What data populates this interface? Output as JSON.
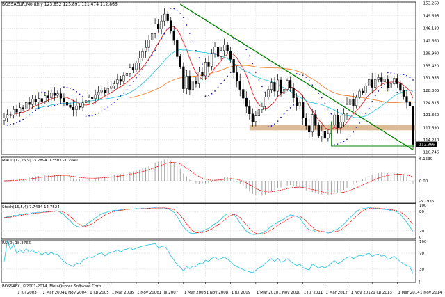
{
  "header": {
    "title": "BOSSAEUR,Monthly  123.852 123.891 111.474 112.866"
  },
  "panels": {
    "macd_label": "MACD(12,26,9) -3.2894 0.3507 -1.2940",
    "stoch_label": "Stoch(15,5,4) 7.7434 14.7524",
    "rsi_label": "RSI(9) 18.3766"
  },
  "footer": {
    "copyright": "BOSSAFX, ©2001-2014, MetaQuotes Software Corp."
  },
  "colors": {
    "background": "#ffffff",
    "grid": "#d8d8d8",
    "candle_bull": "#ffffff",
    "candle_bear": "#000000",
    "ma_red": "#e02020",
    "ma_cyan": "#30c8e0",
    "ma_orange": "#f08030",
    "psar": "#2020c0",
    "trendline": "#008000",
    "support_zone": "#d9b48c",
    "macd_signal": "#ff0000",
    "stoch_main": "#30c8e0",
    "stoch_signal": "#ff0000",
    "rsi": "#30c8e0"
  },
  "chart_data": [
    {
      "type": "candlestick",
      "symbol": "BOSSAEUR",
      "timeframe": "Monthly",
      "last_bar": {
        "open": 123.852,
        "high": 123.891,
        "low": 111.474,
        "close": 112.866
      },
      "yticks": [
        110.746,
        114.21,
        117.69,
        121.36,
        124.815,
        128.305,
        131.955,
        135.42,
        138.99,
        142.56,
        146.13,
        149.695,
        153.26
      ],
      "ylim": [
        110.0,
        153.6
      ],
      "current_price_label": "112.866",
      "xticks": [
        "1 Jul 2003",
        "1 Mar 2004",
        "1 Nov 2004",
        "1 Jul 2005",
        "1 Mar 2006",
        "1 Nov 2006",
        "1 Jul 2007",
        "1 Mar 2008",
        "1 Nov 2008",
        "1 Jul 2009",
        "1 Mar 2010",
        "1 Nov 2010",
        "1 Jul 2011",
        "1 Mar 2012",
        "1 Nov 2012",
        "1 Jul 2013",
        "1 Mar 2014",
        "1 Nov 2014"
      ],
      "close": [
        120.5,
        121.4,
        121.2,
        122.9,
        122.1,
        123.4,
        123.0,
        124.9,
        124.3,
        125.8,
        125.1,
        126.0,
        125.2,
        126.8,
        126.2,
        127.6,
        126.9,
        127.4,
        126.1,
        125.0,
        124.1,
        123.5,
        122.8,
        123.9,
        123.5,
        124.8,
        125.4,
        126.3,
        126.0,
        127.1,
        127.9,
        128.4,
        127.6,
        128.9,
        129.6,
        130.2,
        131.4,
        130.9,
        132.6,
        133.2,
        134.8,
        134.3,
        136.2,
        137.6,
        139.4,
        140.6,
        142.8,
        144.6,
        147.4,
        146.0,
        148.2,
        150.2,
        148.3,
        145.4,
        142.6,
        138.0,
        135.1,
        128.8,
        132.4,
        128.6,
        131.0,
        130.2,
        133.6,
        132.5,
        136.4,
        135.2,
        138.9,
        140.8,
        138.0,
        139.7,
        141.3,
        139.6,
        137.2,
        133.4,
        131.0,
        128.6,
        126.1,
        123.7,
        121.6,
        119.4,
        121.0,
        122.8,
        123.7,
        126.4,
        128.6,
        130.6,
        128.1,
        131.3,
        127.5,
        128.6,
        131.2,
        129.0,
        126.2,
        123.8,
        124.9,
        120.4,
        118.2,
        116.4,
        121.4,
        118.3,
        115.3,
        116.6,
        114.6,
        116.0,
        118.5,
        121.2,
        117.6,
        119.3,
        121.6,
        124.3,
        125.8,
        124.0,
        126.3,
        128.1,
        127.6,
        129.6,
        131.4,
        129.2,
        131.4,
        132.0,
        130.8,
        131.6,
        129.0,
        130.2,
        131.8,
        130.2,
        128.3,
        126.6,
        124.9,
        123.9,
        112.9
      ],
      "trendline": {
        "from": {
          "bar": 56,
          "price": 153.0
        },
        "to": {
          "bar": 130,
          "price": 111.3
        }
      },
      "support_zone": [
        116.9,
        118.4
      ],
      "horizontal_line": 112.4,
      "macd_yticks": [
        "6.1539",
        "0.00",
        "-5.7936"
      ],
      "stoch_yticks": [
        "100",
        "80",
        "20",
        "0"
      ],
      "rsi_yticks": [
        "100",
        "70",
        "30",
        "0"
      ]
    }
  ]
}
